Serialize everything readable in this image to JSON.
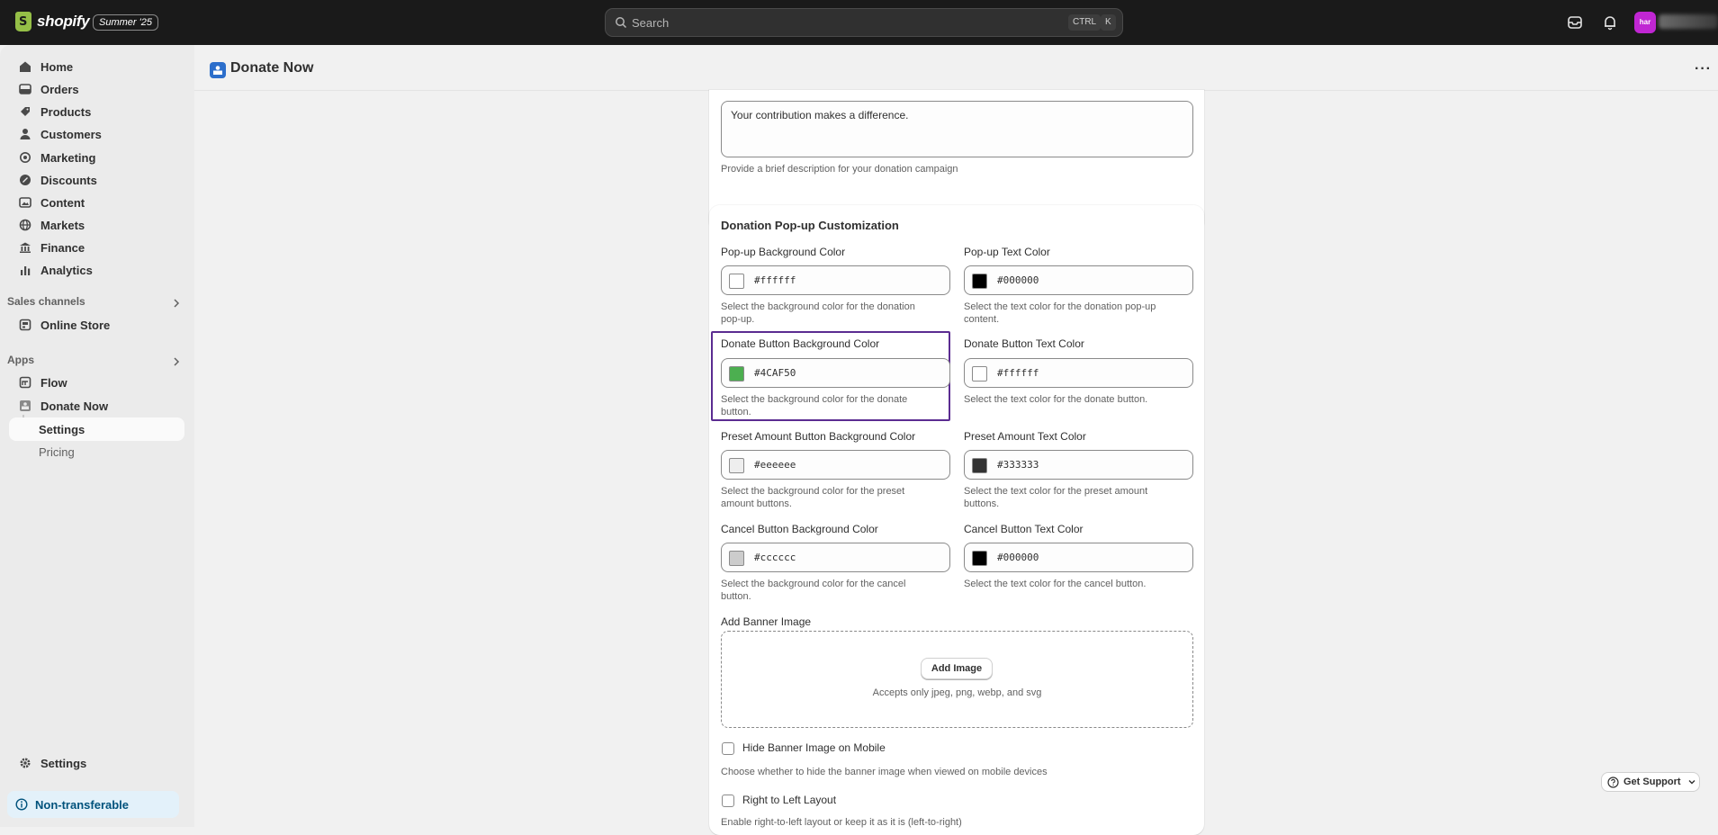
{
  "topbar": {
    "logo_text": "shopify",
    "badge": "Summer '25",
    "search_placeholder": "Search",
    "shortcut_key1": "CTRL",
    "shortcut_key2": "K",
    "avatar_initials": "har"
  },
  "sidebar": {
    "items": [
      {
        "label": "Home",
        "icon": "home-icon"
      },
      {
        "label": "Orders",
        "icon": "orders-icon"
      },
      {
        "label": "Products",
        "icon": "products-icon"
      },
      {
        "label": "Customers",
        "icon": "customers-icon"
      },
      {
        "label": "Marketing",
        "icon": "marketing-icon"
      },
      {
        "label": "Discounts",
        "icon": "discounts-icon"
      },
      {
        "label": "Content",
        "icon": "content-icon"
      },
      {
        "label": "Markets",
        "icon": "markets-icon"
      },
      {
        "label": "Finance",
        "icon": "finance-icon"
      },
      {
        "label": "Analytics",
        "icon": "analytics-icon"
      }
    ],
    "sales_channels_label": "Sales channels",
    "online_store": "Online Store",
    "apps_label": "Apps",
    "flow": "Flow",
    "donate_now": "Donate Now",
    "settings_sub": "Settings",
    "pricing_sub": "Pricing",
    "settings": "Settings",
    "non_transferable": "Non-transferable"
  },
  "page": {
    "title": "Donate Now",
    "more": "···"
  },
  "description_card": {
    "textarea_value": "Your contribution makes a difference.",
    "help": "Provide a brief description for your donation campaign"
  },
  "customization": {
    "title": "Donation Pop-up Customization",
    "popup_bg": {
      "label": "Pop-up Background Color",
      "value": "#ffffff",
      "help1": "Select the background color for the donation",
      "help2": "pop-up."
    },
    "popup_text": {
      "label": "Pop-up Text Color",
      "value": "#000000",
      "help1": "Select the text color for the donation pop-up",
      "help2": "content."
    },
    "donate_bg": {
      "label": "Donate Button Background Color",
      "value": "#4CAF50",
      "help1": "Select the background color for the donate",
      "help2": "button."
    },
    "donate_text": {
      "label": "Donate Button Text Color",
      "value": "#ffffff",
      "help1": "Select the text color for the donate button."
    },
    "preset_bg": {
      "label": "Preset Amount Button Background Color",
      "value": "#eeeeee",
      "help1": "Select the background color for the preset",
      "help2": "amount buttons."
    },
    "preset_text": {
      "label": "Preset Amount Text Color",
      "value": "#333333",
      "help1": "Select the text color for the preset amount",
      "help2": "buttons."
    },
    "cancel_bg": {
      "label": "Cancel Button Background Color",
      "value": "#cccccc",
      "help1": "Select the background color for the cancel",
      "help2": "button."
    },
    "cancel_text": {
      "label": "Cancel Button Text Color",
      "value": "#000000",
      "help1": "Select the text color for the cancel button."
    },
    "banner_label": "Add Banner Image",
    "add_image": "Add Image",
    "accepts": "Accepts only jpeg, png, webp, and svg",
    "hide_banner_label": "Hide Banner Image on Mobile",
    "hide_banner_help": "Choose whether to hide the banner image when viewed on mobile devices",
    "rtl_label": "Right to Left Layout",
    "rtl_help": "Enable right-to-left layout or keep it as it is (left-to-right)"
  },
  "support": {
    "label": "Get Support"
  },
  "colors": {
    "accent_highlight": "#5b2c91",
    "topbar": "#1a1a1a"
  }
}
